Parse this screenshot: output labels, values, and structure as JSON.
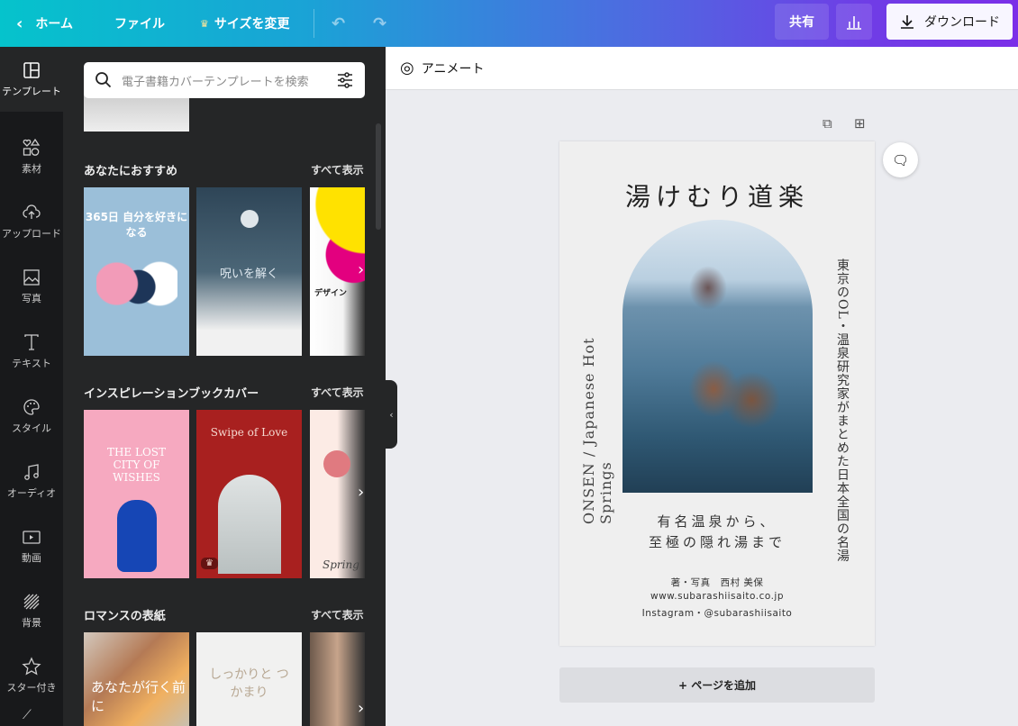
{
  "topbar": {
    "home": "ホーム",
    "file": "ファイル",
    "resize": "サイズを変更",
    "share": "共有",
    "download": "ダウンロード"
  },
  "rail": [
    {
      "label": "テンプレート",
      "icon": "template-icon"
    },
    {
      "label": "素材",
      "icon": "elements-icon"
    },
    {
      "label": "アップロード",
      "icon": "upload-icon"
    },
    {
      "label": "写真",
      "icon": "photo-icon"
    },
    {
      "label": "テキスト",
      "icon": "text-icon"
    },
    {
      "label": "スタイル",
      "icon": "palette-icon"
    },
    {
      "label": "オーディオ",
      "icon": "audio-icon"
    },
    {
      "label": "動画",
      "icon": "video-icon"
    },
    {
      "label": "背景",
      "icon": "background-icon"
    },
    {
      "label": "スター付き",
      "icon": "star-icon"
    }
  ],
  "panel": {
    "search_placeholder": "電子書籍カバーテンプレートを検索",
    "see_all": "すべて表示",
    "sections": [
      {
        "title": "あなたにおすすめ",
        "thumbs": [
          "365日 自分を好きになる",
          "呪いを解く",
          "デザイン"
        ]
      },
      {
        "title": "インスピレーションブックカバー",
        "thumbs": [
          "THE LOST CITY OF WISHES",
          "Swipe of Love",
          "Spring"
        ]
      },
      {
        "title": "ロマンスの表紙",
        "thumbs": [
          "あなたが行く前に",
          "しっかりと つかまり",
          ""
        ]
      }
    ]
  },
  "toolbar": {
    "animate": "アニメート"
  },
  "cover": {
    "title": "湯けむり道楽",
    "left_vertical": "ONSEN / Japanese Hot Springs",
    "right_vertical": "東京のOL・温泉研究家がまとめた日本全国の名湯",
    "subtitle_1": "有名温泉から、",
    "subtitle_2": "至極の隠れ湯まで",
    "author": "著・写真　西村 美保",
    "website": "www.subarashiisaito.co.jp",
    "instagram": "Instagram・@subarashiisaito"
  },
  "add_page": "+ ページを追加"
}
